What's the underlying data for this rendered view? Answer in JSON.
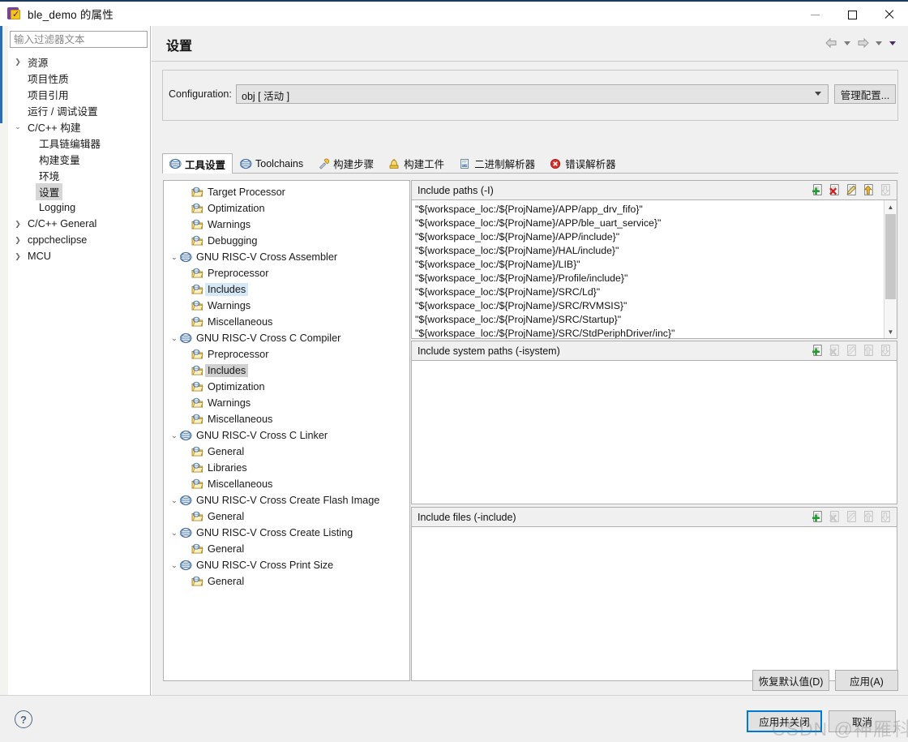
{
  "window": {
    "title": "ble_demo 的属性",
    "icon": "eclipse-properties-icon",
    "minimize_label": "—",
    "maximize_label": "□",
    "close_label": "✕"
  },
  "sidebar": {
    "filter_placeholder": "输入过滤器文本",
    "filter_value": "",
    "items": [
      {
        "label": "资源",
        "indent": 0,
        "twisty": "collapsed",
        "selected": false
      },
      {
        "label": "项目性质",
        "indent": 0,
        "twisty": "none",
        "selected": false
      },
      {
        "label": "项目引用",
        "indent": 0,
        "twisty": "none",
        "selected": false
      },
      {
        "label": "运行 / 调试设置",
        "indent": 0,
        "twisty": "none",
        "selected": false
      },
      {
        "label": "C/C++ 构建",
        "indent": 0,
        "twisty": "expanded",
        "selected": false
      },
      {
        "label": "工具链编辑器",
        "indent": 1,
        "twisty": "none",
        "selected": false
      },
      {
        "label": "构建变量",
        "indent": 1,
        "twisty": "none",
        "selected": false
      },
      {
        "label": "环境",
        "indent": 1,
        "twisty": "none",
        "selected": false
      },
      {
        "label": "设置",
        "indent": 1,
        "twisty": "none",
        "selected": true
      },
      {
        "label": "Logging",
        "indent": 1,
        "twisty": "none",
        "selected": false
      },
      {
        "label": "C/C++ General",
        "indent": 0,
        "twisty": "collapsed",
        "selected": false
      },
      {
        "label": "cppcheclipse",
        "indent": 0,
        "twisty": "collapsed",
        "selected": false
      },
      {
        "label": "MCU",
        "indent": 0,
        "twisty": "collapsed",
        "selected": false
      }
    ]
  },
  "page": {
    "title": "设置",
    "nav_back": "back-arrow",
    "nav_forward": "forward-arrow",
    "nav_menu": "view-menu"
  },
  "configuration": {
    "label": "Configuration:",
    "value": "obj  [ 活动 ]",
    "manage_button": "管理配置..."
  },
  "tabs": [
    {
      "label": "工具设置",
      "icon": "tool-settings-icon",
      "active": true
    },
    {
      "label": "Toolchains",
      "icon": "toolchains-icon",
      "active": false
    },
    {
      "label": "构建步骤",
      "icon": "build-steps-icon",
      "active": false
    },
    {
      "label": "构建工件",
      "icon": "build-artifact-icon",
      "active": false
    },
    {
      "label": "二进制解析器",
      "icon": "binary-parser-icon",
      "active": false
    },
    {
      "label": "错误解析器",
      "icon": "error-parser-icon",
      "active": false
    }
  ],
  "tool_tree": [
    {
      "label": "Target Processor",
      "indent": 1,
      "twisty": "none",
      "icon": "option-folder-icon",
      "select": "none"
    },
    {
      "label": "Optimization",
      "indent": 1,
      "twisty": "none",
      "icon": "option-folder-icon",
      "select": "none"
    },
    {
      "label": "Warnings",
      "indent": 1,
      "twisty": "none",
      "icon": "option-folder-icon",
      "select": "none"
    },
    {
      "label": "Debugging",
      "indent": 1,
      "twisty": "none",
      "icon": "option-folder-icon",
      "select": "none"
    },
    {
      "label": "GNU RISC-V Cross Assembler",
      "indent": 0,
      "twisty": "expanded",
      "icon": "tool-icon",
      "select": "none"
    },
    {
      "label": "Preprocessor",
      "indent": 1,
      "twisty": "none",
      "icon": "option-folder-icon",
      "select": "none"
    },
    {
      "label": "Includes",
      "indent": 1,
      "twisty": "none",
      "icon": "option-folder-icon",
      "select": "blue"
    },
    {
      "label": "Warnings",
      "indent": 1,
      "twisty": "none",
      "icon": "option-folder-icon",
      "select": "none"
    },
    {
      "label": "Miscellaneous",
      "indent": 1,
      "twisty": "none",
      "icon": "option-folder-icon",
      "select": "none"
    },
    {
      "label": "GNU RISC-V Cross C Compiler",
      "indent": 0,
      "twisty": "expanded",
      "icon": "tool-icon",
      "select": "none"
    },
    {
      "label": "Preprocessor",
      "indent": 1,
      "twisty": "none",
      "icon": "option-folder-icon",
      "select": "none"
    },
    {
      "label": "Includes",
      "indent": 1,
      "twisty": "none",
      "icon": "option-folder-icon",
      "select": "gray"
    },
    {
      "label": "Optimization",
      "indent": 1,
      "twisty": "none",
      "icon": "option-folder-icon",
      "select": "none"
    },
    {
      "label": "Warnings",
      "indent": 1,
      "twisty": "none",
      "icon": "option-folder-icon",
      "select": "none"
    },
    {
      "label": "Miscellaneous",
      "indent": 1,
      "twisty": "none",
      "icon": "option-folder-icon",
      "select": "none"
    },
    {
      "label": "GNU RISC-V Cross C Linker",
      "indent": 0,
      "twisty": "expanded",
      "icon": "tool-icon",
      "select": "none"
    },
    {
      "label": "General",
      "indent": 1,
      "twisty": "none",
      "icon": "option-folder-icon",
      "select": "none"
    },
    {
      "label": "Libraries",
      "indent": 1,
      "twisty": "none",
      "icon": "option-folder-icon",
      "select": "none"
    },
    {
      "label": "Miscellaneous",
      "indent": 1,
      "twisty": "none",
      "icon": "option-folder-icon",
      "select": "none"
    },
    {
      "label": "GNU RISC-V Cross Create Flash Image",
      "indent": 0,
      "twisty": "expanded",
      "icon": "tool-icon",
      "select": "none"
    },
    {
      "label": "General",
      "indent": 1,
      "twisty": "none",
      "icon": "option-folder-icon",
      "select": "none"
    },
    {
      "label": "GNU RISC-V Cross Create Listing",
      "indent": 0,
      "twisty": "expanded",
      "icon": "tool-icon",
      "select": "none"
    },
    {
      "label": "General",
      "indent": 1,
      "twisty": "none",
      "icon": "option-folder-icon",
      "select": "none"
    },
    {
      "label": "GNU RISC-V Cross Print Size",
      "indent": 0,
      "twisty": "expanded",
      "icon": "tool-icon",
      "select": "none"
    },
    {
      "label": "General",
      "indent": 1,
      "twisty": "none",
      "icon": "option-folder-icon",
      "select": "none"
    }
  ],
  "sections": {
    "include_paths": {
      "title": "Include paths (-I)",
      "tools": [
        {
          "name": "add-icon",
          "enabled": true
        },
        {
          "name": "delete-icon",
          "enabled": true
        },
        {
          "name": "edit-icon",
          "enabled": true
        },
        {
          "name": "move-up-icon",
          "enabled": true
        },
        {
          "name": "move-down-icon",
          "enabled": false
        }
      ],
      "items": [
        "\"${workspace_loc:/${ProjName}/APP/app_drv_fifo}\"",
        "\"${workspace_loc:/${ProjName}/APP/ble_uart_service}\"",
        "\"${workspace_loc:/${ProjName}/APP/include}\"",
        "\"${workspace_loc:/${ProjName}/HAL/include}\"",
        "\"${workspace_loc:/${ProjName}/LIB}\"",
        "\"${workspace_loc:/${ProjName}/Profile/include}\"",
        "\"${workspace_loc:/${ProjName}/SRC/Ld}\"",
        "\"${workspace_loc:/${ProjName}/SRC/RVMSIS}\"",
        "\"${workspace_loc:/${ProjName}/SRC/Startup}\"",
        "\"${workspace_loc:/${ProjName}/SRC/StdPeriphDriver/inc}\""
      ],
      "scroll_up": "▲",
      "scroll_down": "▼"
    },
    "include_system_paths": {
      "title": "Include system paths (-isystem)",
      "tools": [
        {
          "name": "add-icon",
          "enabled": true
        },
        {
          "name": "delete-icon",
          "enabled": false
        },
        {
          "name": "edit-icon",
          "enabled": false
        },
        {
          "name": "move-up-icon",
          "enabled": false
        },
        {
          "name": "move-down-icon",
          "enabled": false
        }
      ],
      "items": []
    },
    "include_files": {
      "title": "Include files (-include)",
      "tools": [
        {
          "name": "add-icon",
          "enabled": true
        },
        {
          "name": "delete-icon",
          "enabled": false
        },
        {
          "name": "edit-icon",
          "enabled": false
        },
        {
          "name": "move-up-icon",
          "enabled": false
        },
        {
          "name": "move-down-icon",
          "enabled": false
        }
      ],
      "items": []
    }
  },
  "buttons": {
    "restore_defaults": "恢复默认值(D)",
    "restore_defaults_mnemonic": "D",
    "apply": "应用(A)",
    "apply_mnemonic": "A",
    "apply_and_close": "应用并关闭",
    "cancel": "取消",
    "help": "?"
  },
  "watermark": "CSDN @神雁科技",
  "colors": {
    "accent": "#0078d7",
    "selection_blue": "#d5e8f7",
    "selection_gray": "#d0d0d0",
    "panel_bg": "#f0f0f0",
    "titlebar_top": "#1b3a5c"
  }
}
